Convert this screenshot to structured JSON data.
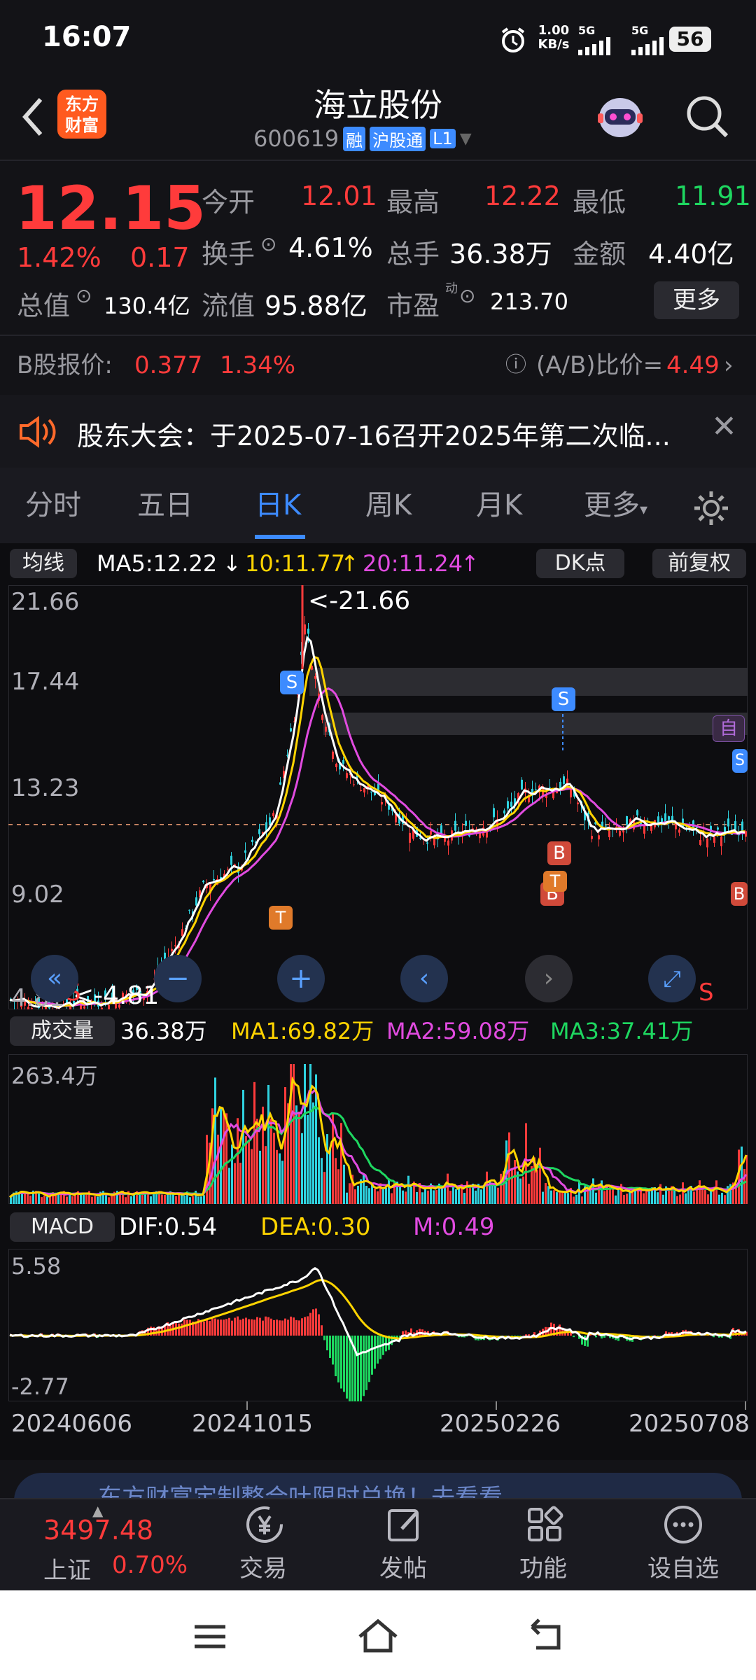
{
  "status_bar": {
    "time": "16:07",
    "net_speed_top": "1.00",
    "net_speed_unit": "KB/s",
    "sig1": "5G",
    "sig2": "5G",
    "battery": "56"
  },
  "header": {
    "logo_line1": "东方",
    "logo_line2": "财富",
    "title": "海立股份",
    "code": "600619",
    "tag_rong": "融",
    "tag_hgt": "沪股通",
    "tag_l1": "L1"
  },
  "quote": {
    "price": "12.15",
    "change_pct": "1.42%",
    "change_amt": "0.17",
    "open_label": "今开",
    "open": "12.01",
    "high_label": "最高",
    "high": "12.22",
    "low_label": "最低",
    "low": "11.91",
    "turnover_label": "换手",
    "turnover": "4.61%",
    "volume_label": "总手",
    "volume": "36.38万",
    "amount_label": "金额",
    "amount": "4.40亿",
    "mcap_label": "总值",
    "mcap": "130.4亿",
    "float_label": "流值",
    "float_cap": "95.88亿",
    "pe_label": "市盈",
    "pe_sup": "动",
    "pe": "213.70",
    "more_button": "更多"
  },
  "bshare": {
    "label": "B股报价:",
    "price": "0.377",
    "pct": "1.34%",
    "ratio_label": "(A/B)比价=",
    "ratio": "4.49"
  },
  "notice": {
    "text": "股东大会：于2025-07-16召开2025年第二次临..."
  },
  "tabs": [
    "分时",
    "五日",
    "日K",
    "周K",
    "月K",
    "更多"
  ],
  "active_tab": "日K",
  "ma_bar": {
    "selector": "均线",
    "ma5": "MA5:12.22",
    "ma10": "10:11.77",
    "ma20": "20:11.24",
    "dk_button": "DK点",
    "adjust_button": "前复权"
  },
  "price_axis": {
    "top": "21.66",
    "l2": "17.44",
    "l3": "13.23",
    "l4": "9.02",
    "bottom": "4.81",
    "max_label": "<-21.66",
    "min_label": "<-4.81"
  },
  "volume_bar": {
    "selector": "成交量",
    "vol": "36.38万",
    "ma1": "MA1:69.82万",
    "ma2": "MA2:59.08万",
    "ma3": "MA3:37.41万",
    "axis_top": "263.4万"
  },
  "macd_bar": {
    "selector": "MACD",
    "dif": "DIF:0.54",
    "dea": "DEA:0.30",
    "m": "M:0.49",
    "axis_top": "5.58",
    "axis_bottom": "-2.77"
  },
  "dates": [
    "20240606",
    "20241015",
    "20250226",
    "20250708"
  ],
  "markers": {
    "s": "S",
    "b": "B",
    "t": "T",
    "self": "自"
  },
  "ticker": {
    "text": "东方财富定制整合吐限时兑换！去看看"
  },
  "bottom_nav": {
    "index_value": "3497.48",
    "index_name": "上证",
    "index_pct": "0.70%",
    "trade": "交易",
    "post": "发帖",
    "func": "功能",
    "watch": "设自选"
  },
  "colors": {
    "up": "#ff3b3b",
    "down": "#1ed760",
    "ma5": "#ffffff",
    "ma10": "#ffd400",
    "ma20": "#e14be0",
    "accent": "#3d8bff"
  }
}
